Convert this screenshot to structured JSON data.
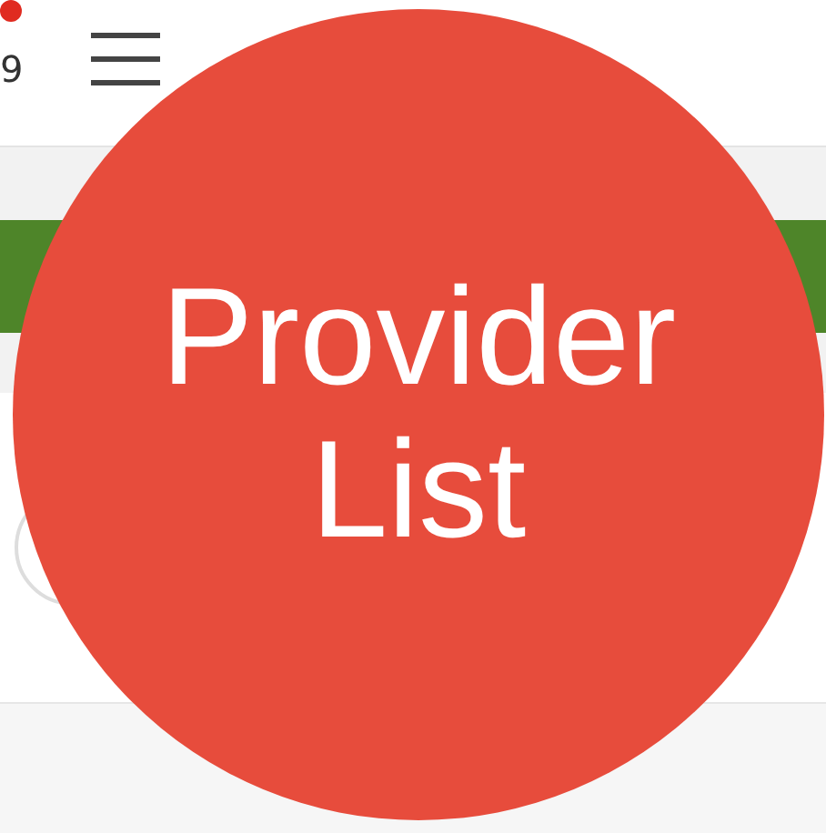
{
  "header": {
    "notification_count": "9"
  },
  "badge": {
    "title": "Provider List"
  }
}
